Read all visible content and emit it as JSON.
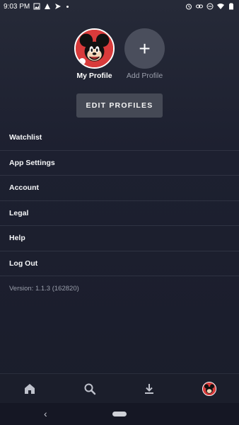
{
  "status": {
    "time": "9:03 PM",
    "icons_left": [
      "image-icon",
      "alert-icon",
      "send-icon",
      "dot-icon"
    ],
    "icons_right": [
      "alarm-icon",
      "link-icon",
      "minus-circle-icon",
      "wifi-icon",
      "battery-icon"
    ]
  },
  "profiles": [
    {
      "label": "My Profile",
      "icon": "mickey-avatar"
    },
    {
      "label": "Add Profile",
      "icon": "plus-icon",
      "symbol": "+"
    }
  ],
  "edit_button": "EDIT PROFILES",
  "menu": [
    "Watchlist",
    "App Settings",
    "Account",
    "Legal",
    "Help",
    "Log Out"
  ],
  "version": "Version: 1.1.3 (162820)",
  "bottom_nav": [
    "home-icon",
    "search-icon",
    "download-icon",
    "profile-avatar-icon"
  ],
  "system_nav": {
    "back": "‹"
  },
  "colors": {
    "accent_avatar": "#d93b3b",
    "button": "#454955",
    "bg_dark": "#1d2030"
  }
}
